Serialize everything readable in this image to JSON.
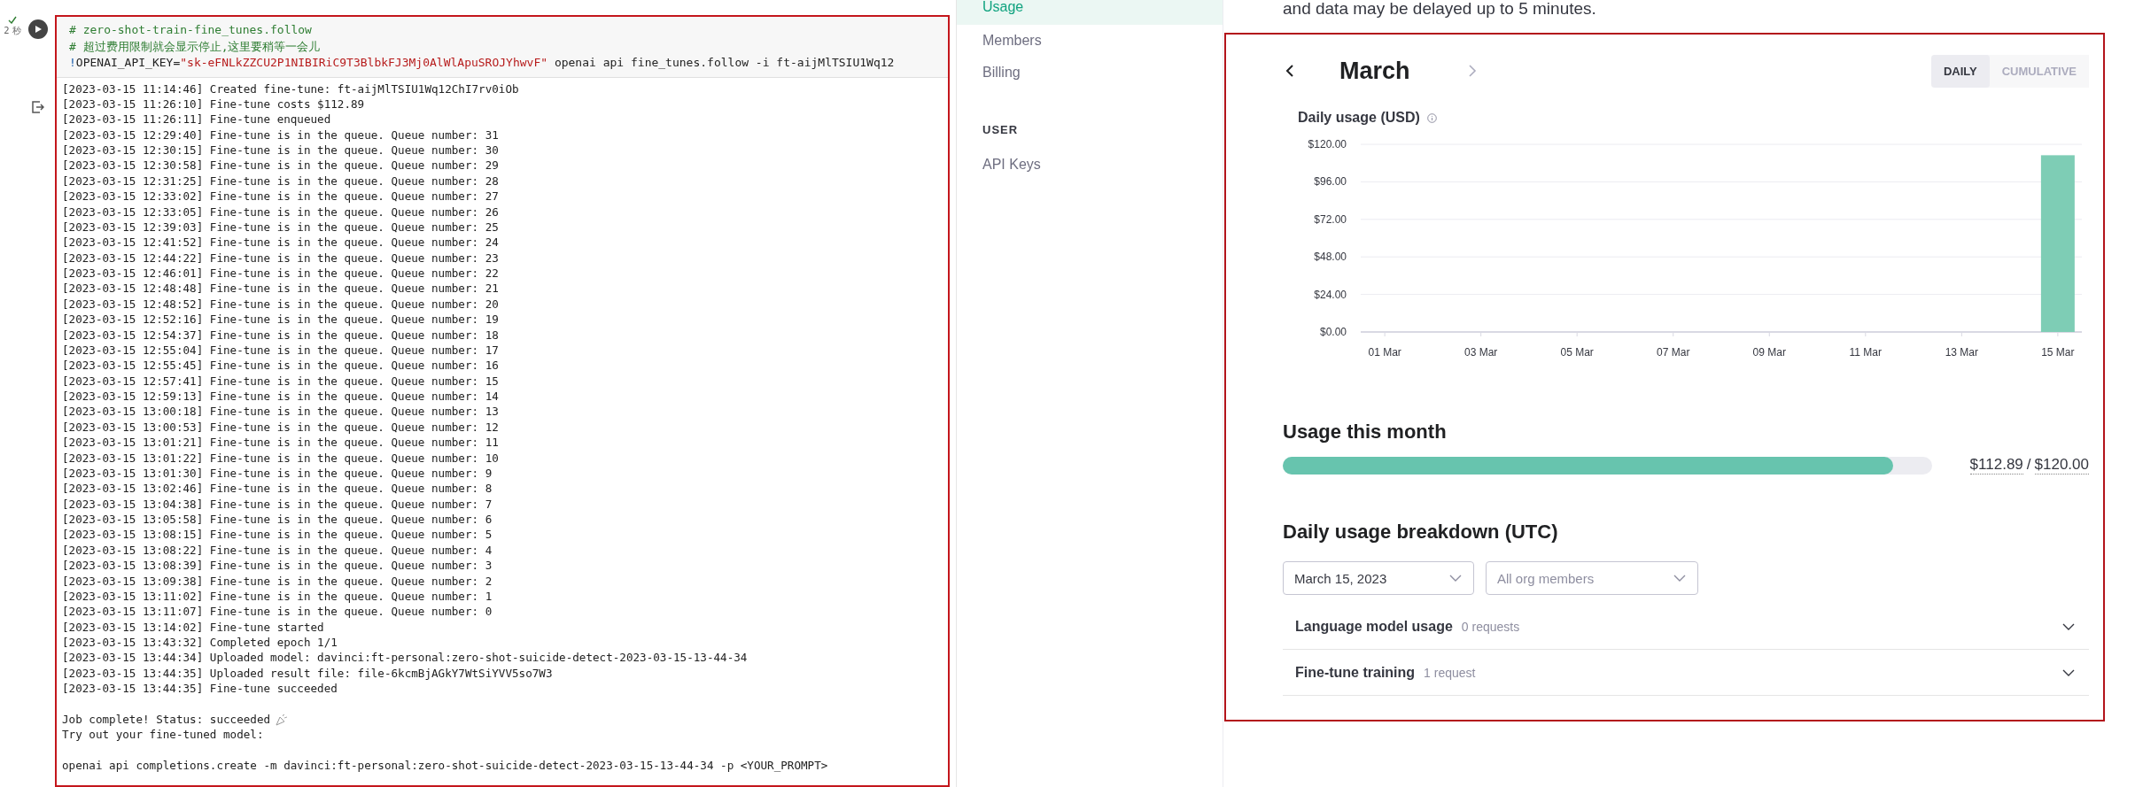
{
  "notebook": {
    "cell_status": "2 秒",
    "code_lines": [
      [
        {
          "kind": "comment",
          "text": "# zero-shot-train-fine_tunes.follow"
        }
      ],
      [
        {
          "kind": "comment",
          "text": "# 超过费用限制就会显示停止,这里要稍等一会儿"
        }
      ],
      [
        {
          "kind": "op",
          "text": "!"
        },
        {
          "kind": "plain",
          "text": "OPENAI_API_KEY="
        },
        {
          "kind": "string",
          "text": "\"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\""
        },
        {
          "kind": "plain",
          "text": " openai api fine_tunes.follow -i ft-aijMlTSIU1Wq12"
        }
      ]
    ],
    "log_lines": [
      "[2023-03-15 11:14:46] Created fine-tune: ft-aijMlTSIU1Wq12ChI7rv0iOb",
      "[2023-03-15 11:26:10] Fine-tune costs $112.89",
      "[2023-03-15 11:26:11] Fine-tune enqueued",
      "[2023-03-15 12:29:40] Fine-tune is in the queue. Queue number: 31",
      "[2023-03-15 12:30:15] Fine-tune is in the queue. Queue number: 30",
      "[2023-03-15 12:30:58] Fine-tune is in the queue. Queue number: 29",
      "[2023-03-15 12:31:25] Fine-tune is in the queue. Queue number: 28",
      "[2023-03-15 12:33:02] Fine-tune is in the queue. Queue number: 27",
      "[2023-03-15 12:33:05] Fine-tune is in the queue. Queue number: 26",
      "[2023-03-15 12:39:03] Fine-tune is in the queue. Queue number: 25",
      "[2023-03-15 12:41:52] Fine-tune is in the queue. Queue number: 24",
      "[2023-03-15 12:44:22] Fine-tune is in the queue. Queue number: 23",
      "[2023-03-15 12:46:01] Fine-tune is in the queue. Queue number: 22",
      "[2023-03-15 12:48:48] Fine-tune is in the queue. Queue number: 21",
      "[2023-03-15 12:48:52] Fine-tune is in the queue. Queue number: 20",
      "[2023-03-15 12:52:16] Fine-tune is in the queue. Queue number: 19",
      "[2023-03-15 12:54:37] Fine-tune is in the queue. Queue number: 18",
      "[2023-03-15 12:55:04] Fine-tune is in the queue. Queue number: 17",
      "[2023-03-15 12:55:45] Fine-tune is in the queue. Queue number: 16",
      "[2023-03-15 12:57:41] Fine-tune is in the queue. Queue number: 15",
      "[2023-03-15 12:59:13] Fine-tune is in the queue. Queue number: 14",
      "[2023-03-15 13:00:18] Fine-tune is in the queue. Queue number: 13",
      "[2023-03-15 13:00:53] Fine-tune is in the queue. Queue number: 12",
      "[2023-03-15 13:01:21] Fine-tune is in the queue. Queue number: 11",
      "[2023-03-15 13:01:22] Fine-tune is in the queue. Queue number: 10",
      "[2023-03-15 13:01:30] Fine-tune is in the queue. Queue number: 9",
      "[2023-03-15 13:02:46] Fine-tune is in the queue. Queue number: 8",
      "[2023-03-15 13:04:38] Fine-tune is in the queue. Queue number: 7",
      "[2023-03-15 13:05:58] Fine-tune is in the queue. Queue number: 6",
      "[2023-03-15 13:08:15] Fine-tune is in the queue. Queue number: 5",
      "[2023-03-15 13:08:22] Fine-tune is in the queue. Queue number: 4",
      "[2023-03-15 13:08:39] Fine-tune is in the queue. Queue number: 3",
      "[2023-03-15 13:09:38] Fine-tune is in the queue. Queue number: 2",
      "[2023-03-15 13:11:02] Fine-tune is in the queue. Queue number: 1",
      "[2023-03-15 13:11:07] Fine-tune is in the queue. Queue number: 0",
      "[2023-03-15 13:14:02] Fine-tune started",
      "[2023-03-15 13:43:32] Completed epoch 1/1",
      "[2023-03-15 13:44:34] Uploaded model: davinci:ft-personal:zero-shot-suicide-detect-2023-03-15-13-44-34",
      "[2023-03-15 13:44:35] Uploaded result file: file-6kcmBjAGkY7WtSiYVV5so7W3",
      "[2023-03-15 13:44:35] Fine-tune succeeded"
    ],
    "job_status": "Job complete! Status: succeeded",
    "try_message": "Try out your fine-tuned model:",
    "command": "openai api completions.create -m davinci:ft-personal:zero-shot-suicide-detect-2023-03-15-13-44-34 -p <YOUR_PROMPT>"
  },
  "sidebar": {
    "items": [
      {
        "kind": "link",
        "label": "Usage",
        "selected": true
      },
      {
        "kind": "link",
        "label": "Members",
        "selected": false
      },
      {
        "kind": "link",
        "label": "Billing",
        "selected": false
      },
      {
        "kind": "heading",
        "label": "USER"
      },
      {
        "kind": "link",
        "label": "API Keys",
        "selected": false
      }
    ]
  },
  "main": {
    "note": "and data may be delayed up to 5 minutes.",
    "month": "March",
    "view_toggle": [
      {
        "label": "DAILY",
        "selected": true
      },
      {
        "label": "CUMULATIVE",
        "selected": false
      }
    ],
    "chart_data": {
      "type": "bar",
      "title": "Daily usage (USD)",
      "categories": [
        "01 Mar",
        null,
        "03 Mar",
        null,
        "05 Mar",
        null,
        "07 Mar",
        null,
        "09 Mar",
        null,
        "11 Mar",
        null,
        "13 Mar",
        null,
        "15 Mar"
      ],
      "values": [
        0,
        0,
        0,
        0,
        0,
        0,
        0,
        0,
        0,
        0,
        0,
        0,
        0,
        0,
        113
      ],
      "color": "#7ecdb5",
      "ylim": [
        0,
        120
      ],
      "grid": true,
      "yticks": [
        {
          "value": 0,
          "label": "$0.00"
        },
        {
          "value": 24,
          "label": "$24.00"
        },
        {
          "value": 48,
          "label": "$48.00"
        },
        {
          "value": 72,
          "label": "$72.00"
        },
        {
          "value": 96,
          "label": "$96.00"
        },
        {
          "value": 120,
          "label": "$120.00"
        }
      ]
    },
    "usage_title": "Usage this month",
    "usage": {
      "level": 0.94,
      "amount": "$112.89",
      "separator": "/",
      "limit": "$120.00"
    },
    "breakdown_title": "Daily usage breakdown (UTC)",
    "filters": [
      {
        "value": "March 15, 2023"
      },
      {
        "placeholder": "All org members"
      }
    ],
    "sections": [
      {
        "title": "Language model usage",
        "count": "0 requests",
        "expanded": false
      },
      {
        "title": "Fine-tune training",
        "count": "1 request",
        "expanded": false
      }
    ]
  }
}
